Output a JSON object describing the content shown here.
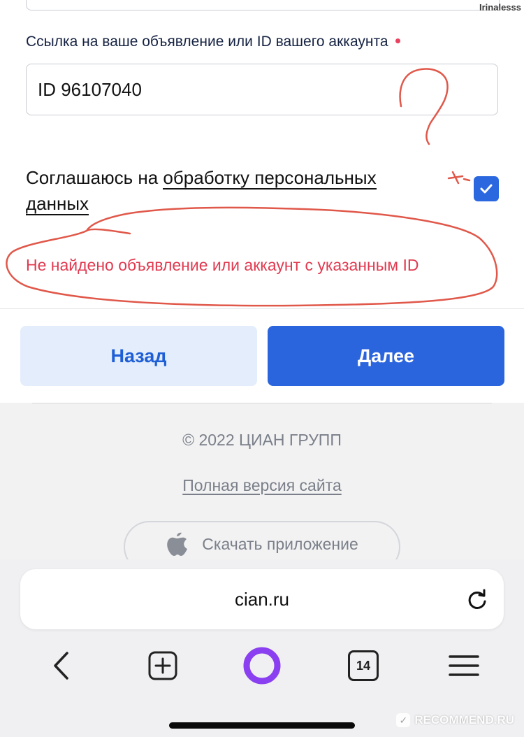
{
  "watermark_top": "Irinalesss",
  "form": {
    "field_label": "Ссылка на ваше объявление или ID вашего аккаунта",
    "id_value": "ID 96107040",
    "consent_prefix": "Соглашаюсь на ",
    "consent_link": "обработку персональных данных",
    "consent_checked": true,
    "error": "Не найдено объявление или аккаунт с указанным ID"
  },
  "buttons": {
    "back": "Назад",
    "next": "Далее"
  },
  "footer": {
    "copyright": "© 2022 ЦИАН ГРУПП",
    "full_version": "Полная версия сайта",
    "download_app": "Скачать приложение"
  },
  "browser": {
    "url": "cian.ru",
    "tabs_count": "14"
  },
  "watermark_bottom": "RECOMMEND.RU",
  "colors": {
    "accent": "#2b65de",
    "error": "#e03a50",
    "annotation": "#e0584a"
  }
}
